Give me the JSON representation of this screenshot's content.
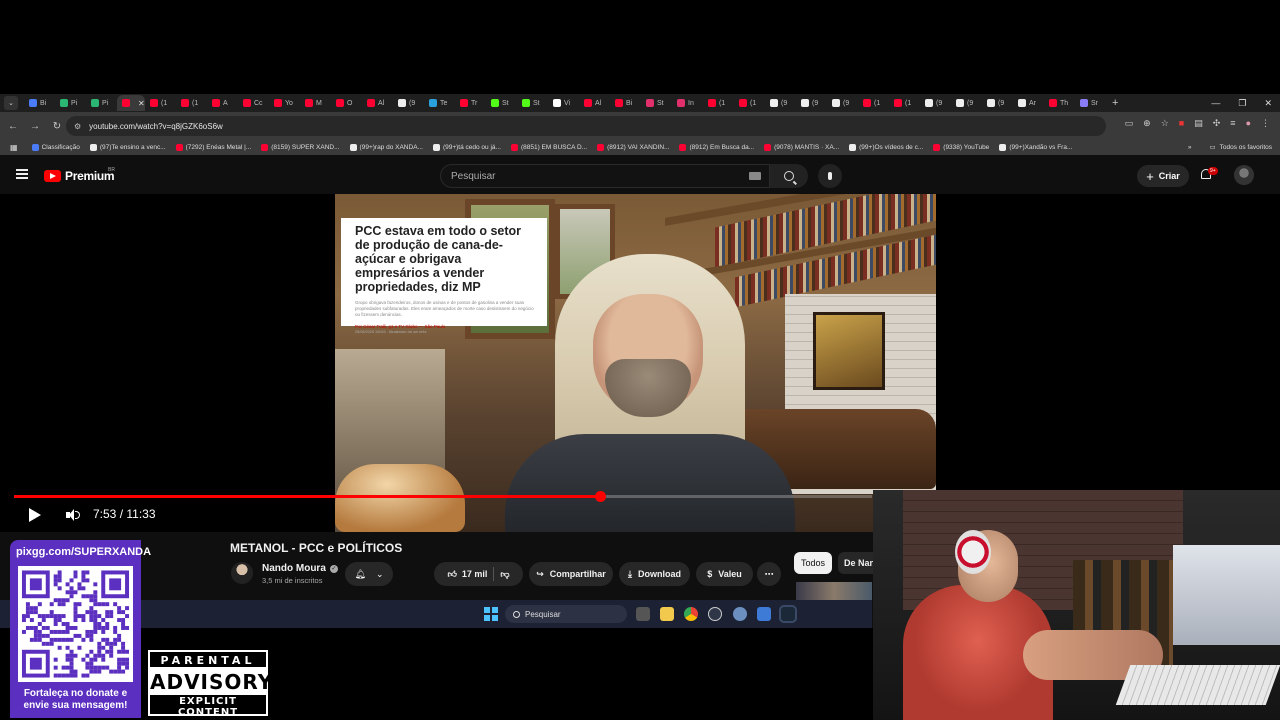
{
  "browser": {
    "tabs": [
      {
        "label": "Bi",
        "color": "#4a7cf7"
      },
      {
        "label": "Pi",
        "color": "#2bb673"
      },
      {
        "label": "Pi",
        "color": "#2bb673"
      },
      {
        "label": "",
        "color": "#ff0033",
        "active": true
      },
      {
        "label": "(1",
        "color": "#ff0033"
      },
      {
        "label": "(1",
        "color": "#ff0033"
      },
      {
        "label": "A",
        "color": "#ff0033"
      },
      {
        "label": "Cc",
        "color": "#ff0033"
      },
      {
        "label": "Yo",
        "color": "#ff0033"
      },
      {
        "label": "M",
        "color": "#ff0033"
      },
      {
        "label": "O",
        "color": "#ff0033"
      },
      {
        "label": "Al",
        "color": "#ff0033"
      },
      {
        "label": "(9",
        "color": "#eeeeee"
      },
      {
        "label": "Te",
        "color": "#2aa1da"
      },
      {
        "label": "Tr",
        "color": "#ff0033"
      },
      {
        "label": "St",
        "color": "#53fc18"
      },
      {
        "label": "St",
        "color": "#53fc18"
      },
      {
        "label": "Vi",
        "color": "#ffffff"
      },
      {
        "label": "Al",
        "color": "#ff0033"
      },
      {
        "label": "Bi",
        "color": "#ff0033"
      },
      {
        "label": "St",
        "color": "#e1306c"
      },
      {
        "label": "In",
        "color": "#e1306c"
      },
      {
        "label": "(1",
        "color": "#ff0033"
      },
      {
        "label": "(1",
        "color": "#ff0033"
      },
      {
        "label": "(9",
        "color": "#eeeeee"
      },
      {
        "label": "(9",
        "color": "#eeeeee"
      },
      {
        "label": "(9",
        "color": "#eeeeee"
      },
      {
        "label": "(1",
        "color": "#ff0033"
      },
      {
        "label": "(1",
        "color": "#ff0033"
      },
      {
        "label": "(9",
        "color": "#eeeeee"
      },
      {
        "label": "(9",
        "color": "#eeeeee"
      },
      {
        "label": "(9",
        "color": "#eeeeee"
      },
      {
        "label": "Ar",
        "color": "#eeeeee"
      },
      {
        "label": "Th",
        "color": "#ff0033"
      },
      {
        "label": "Sr",
        "color": "#8a7cf7"
      }
    ],
    "new_tab": "+",
    "window_controls": {
      "minimize": "—",
      "maximize": "❐",
      "close": "✕"
    },
    "url": "youtube.com/watch?v=q8jGZK6oS6w",
    "bookmarks": [
      {
        "label": "Classificação",
        "color": "#4a7cf7"
      },
      {
        "label": "(97)Te ensino a venc...",
        "color": "#eeeeee"
      },
      {
        "label": "(7292) Enéas Metal |...",
        "color": "#ff0033"
      },
      {
        "label": "(8159) SUPER XAND...",
        "color": "#ff0033"
      },
      {
        "label": "(99+)rap do XANDÃ...",
        "color": "#eeeeee"
      },
      {
        "label": "(99+)tá cedo ou já...",
        "color": "#eeeeee"
      },
      {
        "label": "(8851) EM BUSCA D...",
        "color": "#ff0033"
      },
      {
        "label": "(8912) VAI XANDIN...",
        "color": "#ff0033"
      },
      {
        "label": "(8912) Em Busca da...",
        "color": "#ff0033"
      },
      {
        "label": "(9078) MANTIS · XA...",
        "color": "#ff0033"
      },
      {
        "label": "(99+)Os vídeos de c...",
        "color": "#eeeeee"
      },
      {
        "label": "(9338) YouTube",
        "color": "#ff0033"
      },
      {
        "label": "(99+)Xandão vs Fra...",
        "color": "#eeeeee"
      }
    ],
    "all_bookmarks": "Todos os favoritos"
  },
  "youtube": {
    "logo_text": "Premium",
    "logo_region": "BR",
    "search_placeholder": "Pesquisar",
    "create_label": "Criar",
    "notification_count": "9+",
    "article": {
      "title": "PCC estava em todo o setor de produção de cana-de-açúcar e obrigava empresários a vender propriedades, diz MP",
      "subtitle": "Grupo obrigava fazendeiros, donos de usinas e de postos de gasolina a vender suas propriedades subfaturadas. Eles eram ameaçados de morte caso desistissem do negócio ou fizessem denúncias.",
      "byline": "Por César Tralli, g1 e TV Globo — São Paulo",
      "date": "28/08/2025 10h53 · Atualizado há um mês"
    },
    "player": {
      "current_time": "7:53",
      "duration": "11:33",
      "time_display": "7:53 / 11:33",
      "progress_fraction": 0.6825
    },
    "video_title": "METANOL - PCC e POLÍTICOS",
    "channel": {
      "name": "Nando Moura",
      "subscribers": "3,5 mi de inscritos"
    },
    "actions": {
      "likes": "17 mil",
      "share": "Compartilhar",
      "download": "Download",
      "thanks": "Valeu",
      "more": "⋯"
    },
    "chips": {
      "all": "Todos",
      "channel": "De Nan"
    }
  },
  "taskbar": {
    "search_placeholder": "Pesquisar"
  },
  "overlay": {
    "donate_url": "pixgg.com/SUPERXANDA",
    "donate_message": "Fortaleça no donate e envie sua mensagem!",
    "advisory_top": "PARENTAL",
    "advisory_mid": "ADVISORY",
    "advisory_bot": "EXPLICIT CONTENT"
  },
  "colors": {
    "accent_red": "#ff0000",
    "yt_bg": "#0f0f0f",
    "donate_purple": "#5b2fbf",
    "taskbar": "#1c2233"
  }
}
